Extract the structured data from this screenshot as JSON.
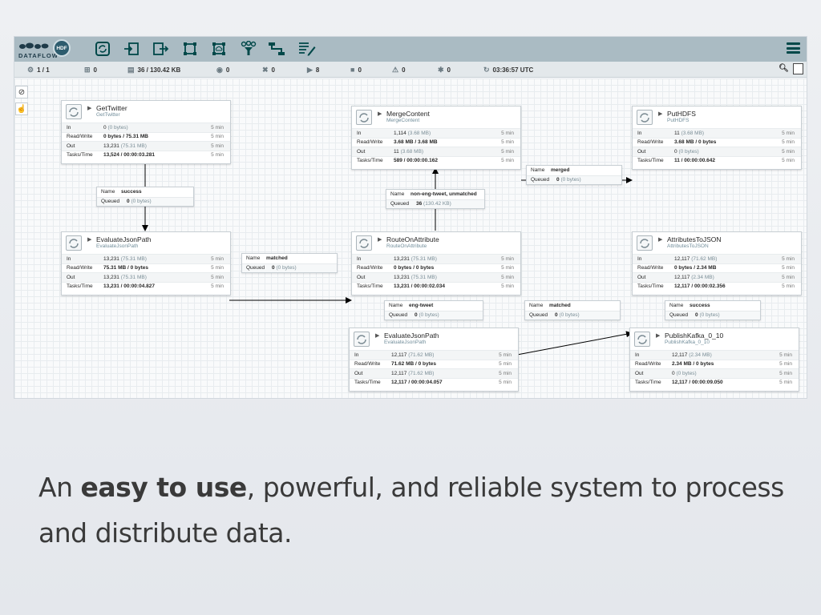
{
  "app": {
    "logo_text": "DATAFLOW",
    "badge": "HDF",
    "toolbar": [
      "processor-icon",
      "input-port-icon",
      "output-port-icon",
      "process-group-icon",
      "remote-process-group-icon",
      "funnel-icon",
      "template-icon",
      "label-icon"
    ],
    "accent": "#004849"
  },
  "status": {
    "threads": "1 / 1",
    "transmitting": "0",
    "queued": "36 / 130.42 KB",
    "invalid": "0",
    "running_count": "0",
    "running": "8",
    "stopped": "0",
    "warning": "0",
    "disabled": "0",
    "last_refresh": "03:36:57 UTC"
  },
  "processors": [
    {
      "name": "GetTwitter",
      "type": "GetTwitter",
      "in": "0",
      "in_paren": "(0 bytes)",
      "rw": "0 bytes / 75.31 MB",
      "out": "13,231",
      "out_paren": "(75.31 MB)",
      "tasks": "13,524 / 00:00:03.281"
    },
    {
      "name": "MergeContent",
      "type": "MergeContent",
      "in": "1,114",
      "in_paren": "(3.68 MB)",
      "rw": "3.68 MB / 3.68 MB",
      "out": "11",
      "out_paren": "(3.68 MB)",
      "tasks": "589 / 00:00:00.162"
    },
    {
      "name": "PutHDFS",
      "type": "PutHDFS",
      "in": "11",
      "in_paren": "(3.68 MB)",
      "rw": "3.68 MB / 0 bytes",
      "out": "0",
      "out_paren": "(0 bytes)",
      "tasks": "11 / 00:00:00.642"
    },
    {
      "name": "EvaluateJsonPath",
      "type": "EvaluateJsonPath",
      "in": "13,231",
      "in_paren": "(75.31 MB)",
      "rw": "75.31 MB / 0 bytes",
      "out": "13,231",
      "out_paren": "(75.31 MB)",
      "tasks": "13,231 / 00:00:04.827"
    },
    {
      "name": "RouteOnAttribute",
      "type": "RouteOnAttribute",
      "in": "13,231",
      "in_paren": "(75.31 MB)",
      "rw": "0 bytes / 0 bytes",
      "out": "13,231",
      "out_paren": "(75.31 MB)",
      "tasks": "13,231 / 00:00:02.034"
    },
    {
      "name": "AttributesToJSON",
      "type": "AttributesToJSON",
      "in": "12,117",
      "in_paren": "(71.62 MB)",
      "rw": "0 bytes / 2.34 MB",
      "out": "12,117",
      "out_paren": "(2.34 MB)",
      "tasks": "12,117 / 00:00:02.356"
    },
    {
      "name": "EvaluateJsonPath",
      "type": "EvaluateJsonPath",
      "in": "12,117",
      "in_paren": "(71.62 MB)",
      "rw": "71.62 MB / 0 bytes",
      "out": "12,117",
      "out_paren": "(71.62 MB)",
      "tasks": "12,117 / 00:00:04.057"
    },
    {
      "name": "PublishKafka_0_10",
      "type": "PublishKafka_0_10",
      "in": "12,117",
      "in_paren": "(2.34 MB)",
      "rw": "2.34 MB / 0 bytes",
      "out": "0",
      "out_paren": "(0 bytes)",
      "tasks": "12,117 / 00:00:09.050"
    }
  ],
  "row_labels": {
    "in": "In",
    "rw": "Read/Write",
    "out": "Out",
    "tasks": "Tasks/Time",
    "window": "5 min"
  },
  "label_keys": {
    "name": "Name",
    "queued": "Queued"
  },
  "connections": [
    {
      "name": "success",
      "queued": "0",
      "queued_paren": "(0 bytes)"
    },
    {
      "name": "merged",
      "queued": "0",
      "queued_paren": "(0 bytes)"
    },
    {
      "name": "non-eng-tweet, unmatched",
      "queued": "36",
      "queued_paren": "(130.42 KB)"
    },
    {
      "name": "matched",
      "queued": "0",
      "queued_paren": "(0 bytes)"
    },
    {
      "name": "eng-tweet",
      "queued": "0",
      "queued_paren": "(0 bytes)"
    },
    {
      "name": "matched",
      "queued": "0",
      "queued_paren": "(0 bytes)"
    },
    {
      "name": "success",
      "queued": "0",
      "queued_paren": "(0 bytes)"
    }
  ],
  "caption": {
    "pre": "An ",
    "bold": "easy to use",
    "post": ", powerful, and reliable system to process and distribute data."
  }
}
